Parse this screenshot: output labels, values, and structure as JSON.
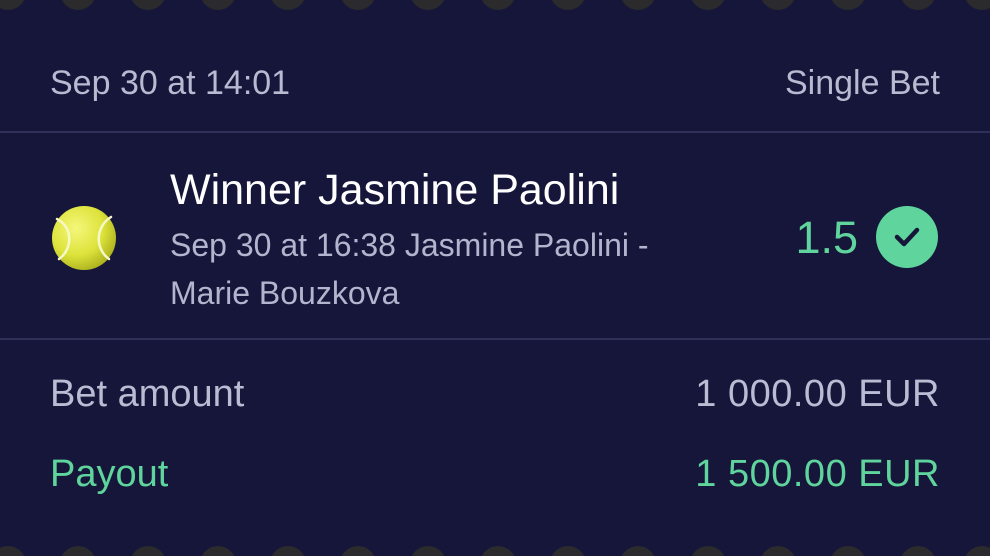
{
  "header": {
    "date": "Sep 30 at 14:01",
    "bet_type": "Single Bet"
  },
  "selection": {
    "sport_icon": "tennis-ball-icon",
    "title": "Winner Jasmine Paolini",
    "subtitle": "Sep 30 at 16:38 Jasmine Paolini - Marie Bouzkova",
    "odds": "1.5",
    "status_icon": "checkmark-icon"
  },
  "summary": {
    "bet_amount_label": "Bet amount",
    "bet_amount_value": "1 000.00 EUR",
    "payout_label": "Payout",
    "payout_value": "1 500.00 EUR"
  },
  "colors": {
    "background": "#15163a",
    "accent_green": "#5fd49c",
    "muted_text": "#b7bad0",
    "divider": "#2e3057"
  }
}
